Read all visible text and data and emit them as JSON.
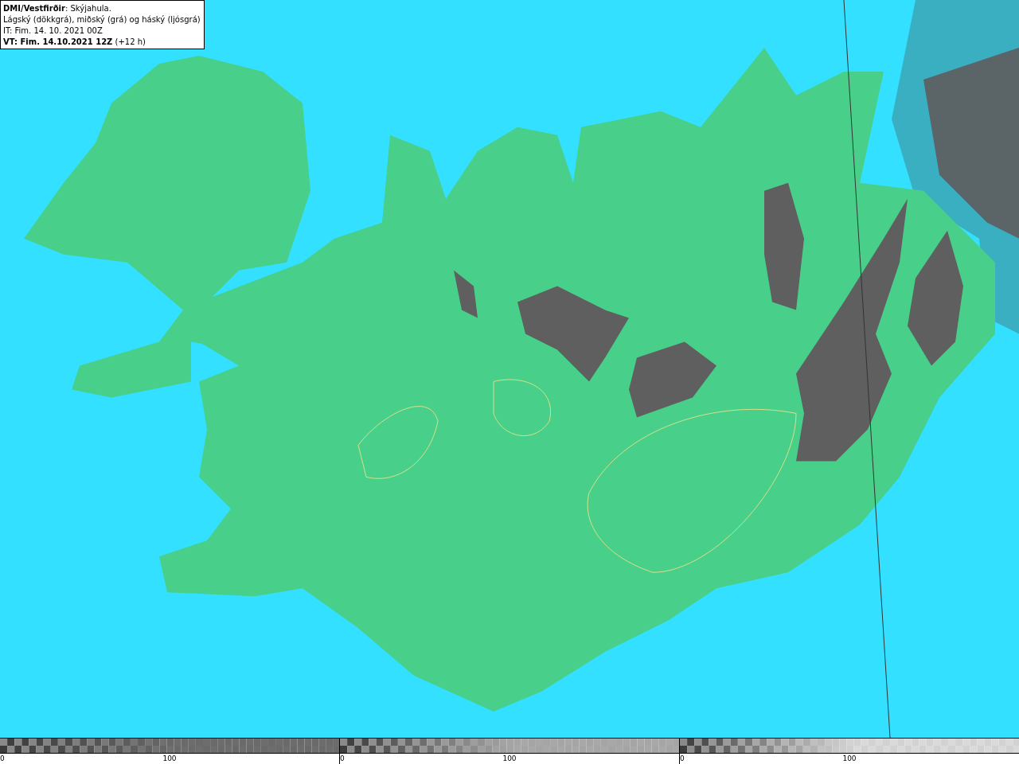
{
  "info_box": {
    "lines": [
      "**DMI/Vestfirðir**: Skýjahula.",
      "Lágský (dökkgrá), miðský (grá) og háský (ljósgrá)",
      "IT: Fim. 14. 10. 2021 00Z",
      "**VT: Fim. 14.10.2021 12Z** (+12 h)"
    ]
  },
  "legends": [
    {
      "color": "#6a6a6a",
      "ticks": [
        "0",
        "100"
      ]
    },
    {
      "color": "#a8a8a8",
      "ticks": [
        "0",
        "100"
      ]
    },
    {
      "color": "#dadada",
      "ticks": [
        "0",
        "100"
      ]
    }
  ]
}
